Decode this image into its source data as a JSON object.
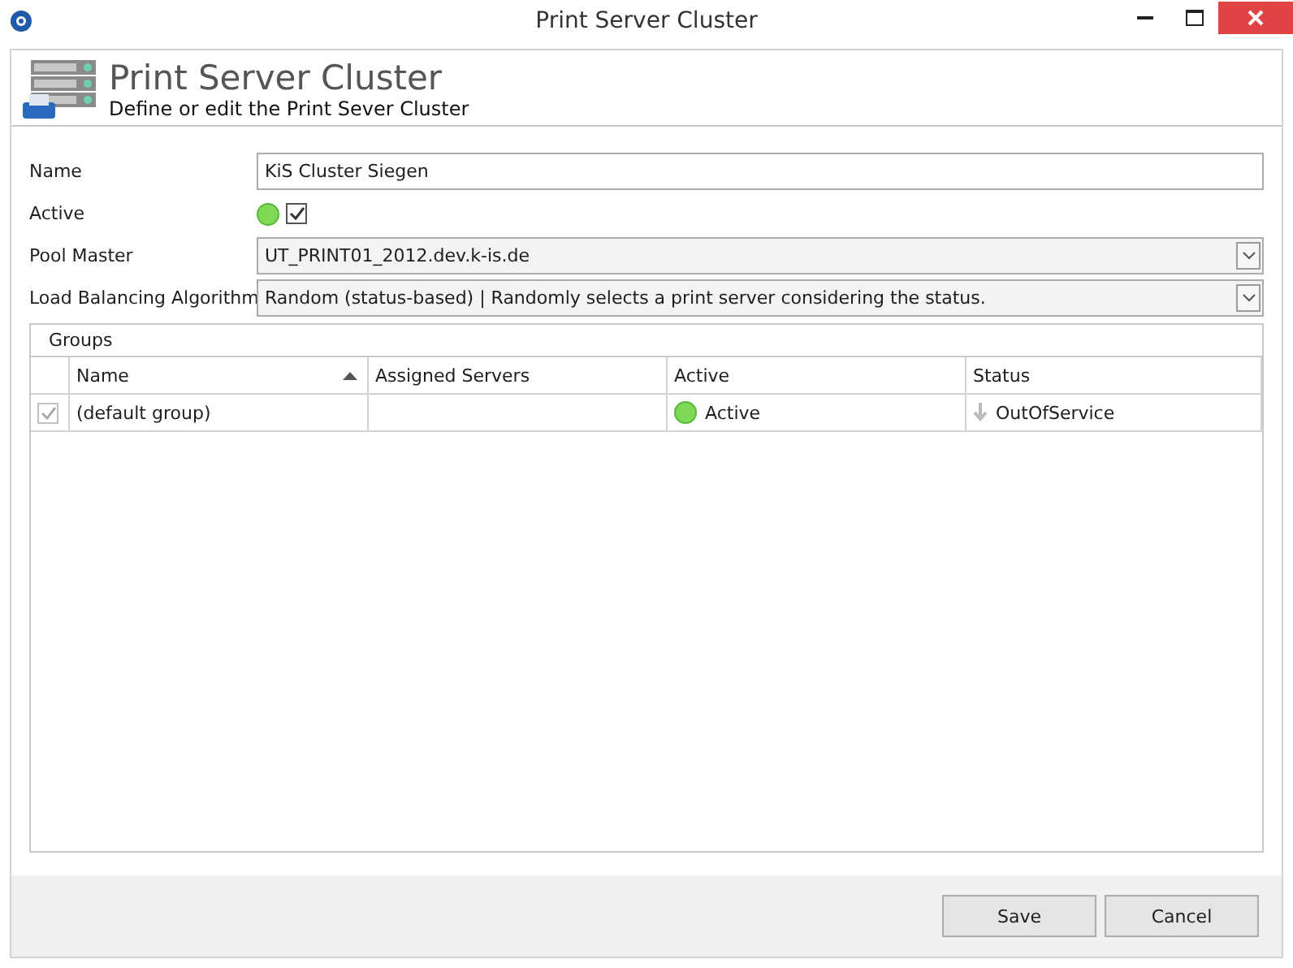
{
  "window": {
    "title": "Print Server Cluster"
  },
  "header": {
    "title": "Print Server Cluster",
    "subtitle": "Define or edit the Print Sever Cluster"
  },
  "form": {
    "name_label": "Name",
    "name_value": "KiS Cluster Siegen",
    "active_label": "Active",
    "active_checked": true,
    "active_on": true,
    "pool_master_label": "Pool Master",
    "pool_master_value": "UT_PRINT01_2012.dev.k-is.de",
    "algorithm_label": "Load Balancing Algorithm",
    "algorithm_value": "Random (status-based) | Randomly selects a print server considering the status."
  },
  "groups": {
    "title": "Groups",
    "columns": [
      {
        "label": "Name",
        "sorted": true
      },
      {
        "label": "Assigned Servers",
        "sorted": false
      },
      {
        "label": "Active",
        "sorted": false
      },
      {
        "label": "Status",
        "sorted": false
      }
    ],
    "rows": [
      {
        "checked": true,
        "name": "(default group)",
        "assigned_servers": "",
        "active": "Active",
        "active_on": true,
        "status": "OutOfService"
      }
    ]
  },
  "buttons": [
    "Save",
    "Cancel"
  ]
}
